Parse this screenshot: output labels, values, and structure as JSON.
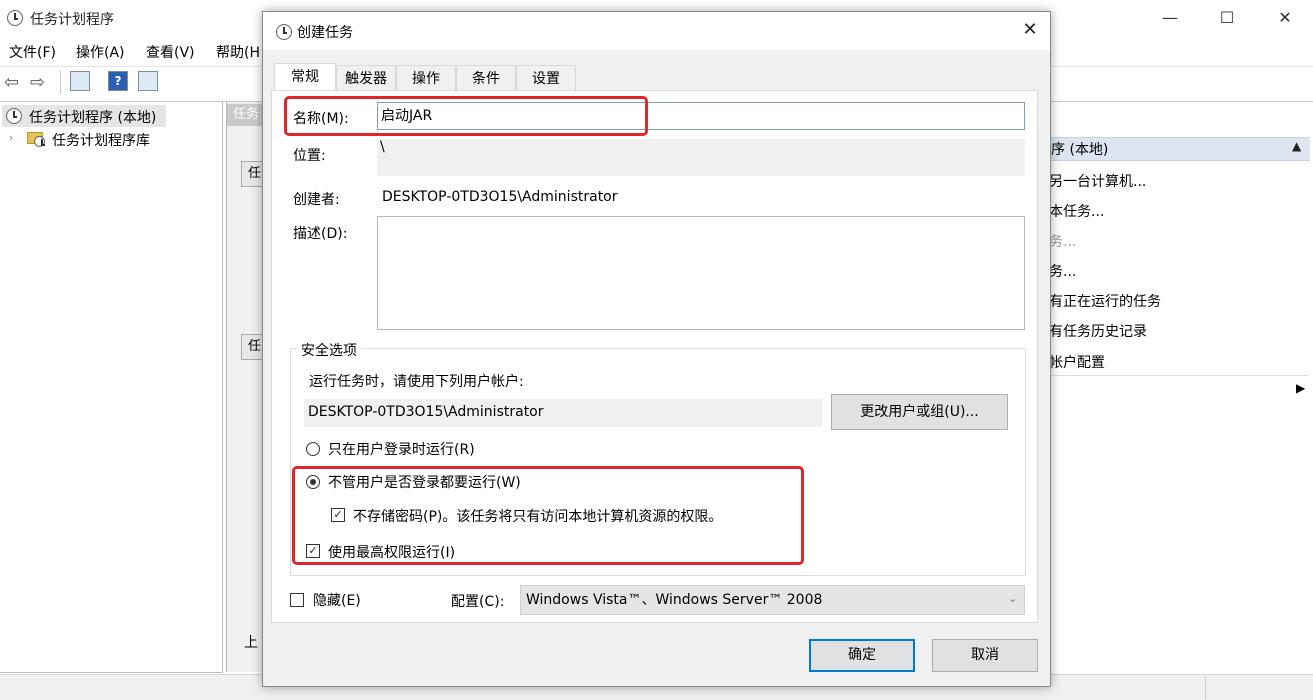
{
  "main_window": {
    "title": "任务计划程序",
    "controls": {
      "minimize": "—",
      "maximize": "☐",
      "close": "✕"
    },
    "menu": [
      "文件(F)",
      "操作(A)",
      "查看(V)",
      "帮助(H"
    ],
    "toolbar": {
      "back": "⇦",
      "forward": "⇨",
      "help": "?"
    },
    "tree": {
      "root": "任务计划程序 (本地)",
      "child": "任务计划程序库",
      "child_arrow": "›"
    },
    "middle_pane": {
      "header": "任务",
      "box1": "任",
      "box2": "任",
      "footer": "上"
    },
    "actions_panel": {
      "header": "序 (本地)",
      "header_caret": "▲",
      "items": [
        {
          "label": "另一台计算机...",
          "enabled": true
        },
        {
          "label": "本任务...",
          "enabled": true
        },
        {
          "label": "务...",
          "enabled": false
        },
        {
          "label": "务...",
          "enabled": true
        },
        {
          "label": "有正在运行的任务",
          "enabled": true
        },
        {
          "label": "有任务历史记录",
          "enabled": true
        },
        {
          "label": "帐户配置",
          "enabled": true
        }
      ],
      "submenu_arrow": "▶"
    }
  },
  "dialog": {
    "title": "创建任务",
    "close": "✕",
    "tabs": [
      "常规",
      "触发器",
      "操作",
      "条件",
      "设置"
    ],
    "active_tab": "常规",
    "name_label": "名称(M):",
    "name_value": "启动JAR",
    "location_label": "位置:",
    "location_value": "\\",
    "author_label": "创建者:",
    "author_value": "DESKTOP-0TD3O15\\Administrator",
    "description_label": "描述(D):",
    "description_value": "",
    "security": {
      "group_title": "安全选项",
      "run_as_prompt": "运行任务时，请使用下列用户帐户:",
      "user_account": "DESKTOP-0TD3O15\\Administrator",
      "change_user_button": "更改用户或组(U)...",
      "radio_logged_on": "只在用户登录时运行(R)",
      "radio_whether_logged_on": "不管用户是否登录都要运行(W)",
      "selected_radio": "whether_logged_on",
      "no_store_password": "不存储密码(P)。该任务将只有访问本地计算机资源的权限。",
      "no_store_password_checked": true,
      "highest_privileges": "使用最高权限运行(I)",
      "highest_privileges_checked": true
    },
    "hidden_label": "隐藏(E)",
    "hidden_checked": false,
    "config_label": "配置(C):",
    "config_value": "Windows Vista™、Windows Server™ 2008",
    "ok_button": "确定",
    "cancel_button": "取消"
  },
  "colors": {
    "highlight_red": "#e0262b",
    "focus_blue": "#0078d7",
    "dialog_bg": "#f0f0f0"
  }
}
